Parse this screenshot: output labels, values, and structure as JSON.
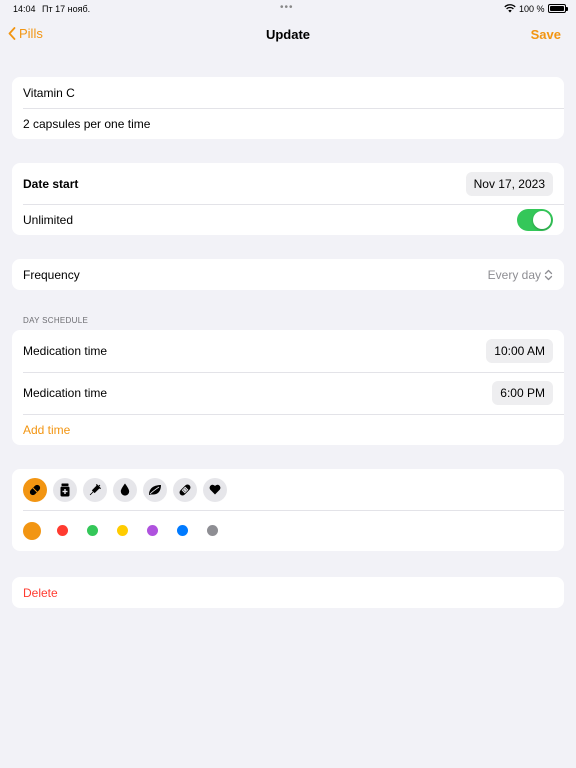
{
  "status_bar": {
    "time": "14:04",
    "date": "Пт 17 нояб.",
    "battery": "100 %"
  },
  "nav": {
    "back_label": "Pills",
    "title": "Update",
    "save_label": "Save"
  },
  "pill": {
    "name": "Vitamin C",
    "dosage": "2 capsules per one time"
  },
  "dates": {
    "start_label": "Date start",
    "start_value": "Nov 17, 2023",
    "unlimited_label": "Unlimited",
    "unlimited_on": true
  },
  "frequency": {
    "label": "Frequency",
    "value": "Every day"
  },
  "schedule": {
    "section_title": "DAY SCHEDULE",
    "times": [
      {
        "label": "Medication time",
        "value": "10:00 AM"
      },
      {
        "label": "Medication time",
        "value": "6:00 PM"
      }
    ],
    "add_label": "Add time"
  },
  "appearance": {
    "icons": [
      "pill-icon",
      "medicine-bottle-icon",
      "syringe-icon",
      "drop-icon",
      "leaf-icon",
      "bandage-icon",
      "heart-icon"
    ],
    "selected_icon": 0,
    "colors": [
      "#f29512",
      "#ff3b30",
      "#34c759",
      "#ffcc00",
      "#af52de",
      "#007aff",
      "#8e8e93"
    ],
    "selected_color": 0
  },
  "actions": {
    "delete_label": "Delete"
  },
  "theme": {
    "accent": "#f29512",
    "destructive": "#ff3b30",
    "toggle_on": "#34c759"
  }
}
